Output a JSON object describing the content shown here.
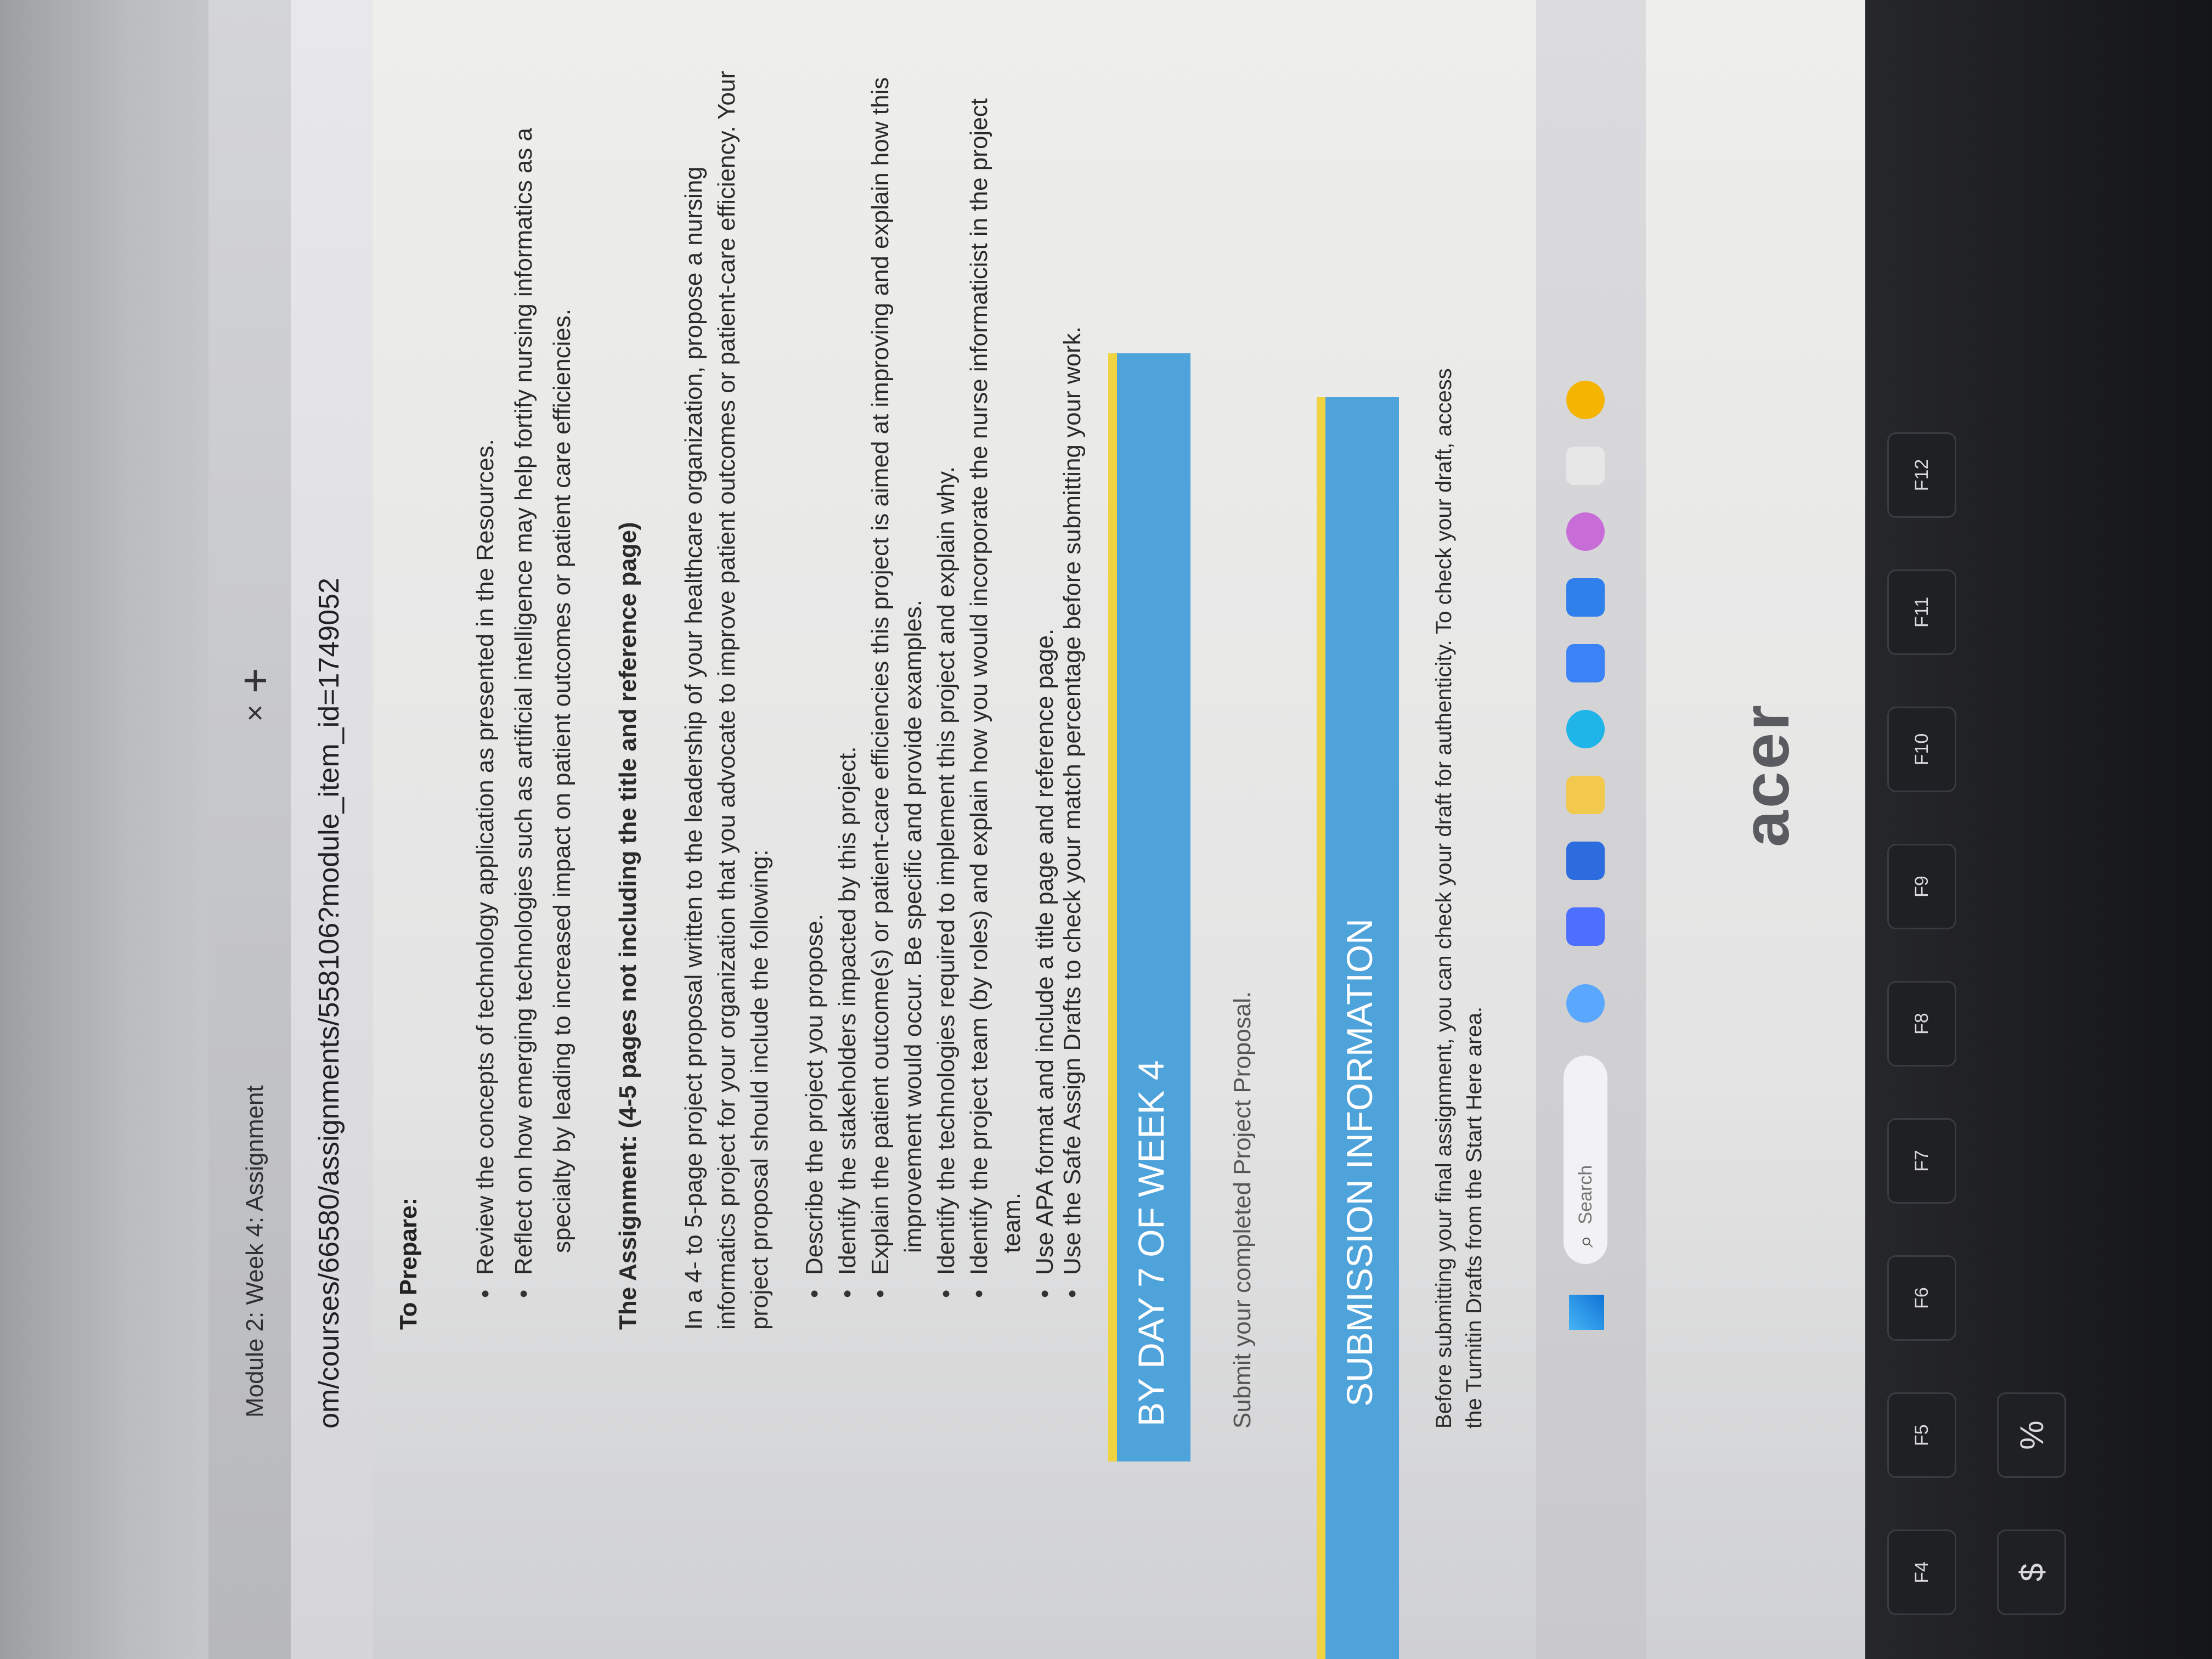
{
  "browser": {
    "tab_title": "Module 2: Week 4: Assignment",
    "tab_close": "×",
    "new_tab": "+",
    "url": "om/courses/66580/assignments/558106?module_item_id=1749052"
  },
  "prepare": {
    "heading": "To Prepare:",
    "items": [
      "Review the concepts of technology application as presented in the Resources.",
      "Reflect on how emerging technologies such as artificial intelligence may help fortify nursing informatics as a",
      "specialty by leading to increased impact on patient outcomes or patient care efficiencies."
    ]
  },
  "assignment": {
    "heading": "The Assignment: (4-5 pages not including the title and reference page)",
    "intro": [
      "In a 4- to 5-page project proposal written to the leadership of your healthcare organization, propose a nursing",
      "informatics project for your organization that you advocate to improve patient outcomes or patient-care efficiency. Your",
      "project proposal should include the following:"
    ],
    "items": [
      "Describe the project you propose.",
      "Identify the stakeholders impacted by this project.",
      "Explain the patient outcome(s) or patient-care efficiencies this project is aimed at improving and explain how this",
      "improvement would occur. Be specific and provide examples.",
      "Identify the technologies required to implement this project and explain why.",
      "Identify the project team (by roles) and explain how you would incorporate the nurse informaticist in the project",
      "team.",
      "Use APA format and include a title page and reference page.",
      "Use the Safe Assign Drafts to check your match percentage before submitting your work."
    ]
  },
  "week_banner": "BY DAY 7 OF WEEK 4",
  "submit_text": "Submit your completed Project Proposal.",
  "submission_banner": "SUBMISSION INFORMATION",
  "submission_text": [
    "Before submitting your final assignment, you can check your draft for authenticity. To check your draft, access",
    "the Turnitin Drafts from the Start Here area."
  ],
  "taskbar": {
    "search_label": "Search"
  },
  "brand": "acer",
  "keys": [
    "F4",
    "F5",
    "F6",
    "F7",
    "F8",
    "F9",
    "F10",
    "F11",
    "F12",
    "$",
    "%"
  ]
}
